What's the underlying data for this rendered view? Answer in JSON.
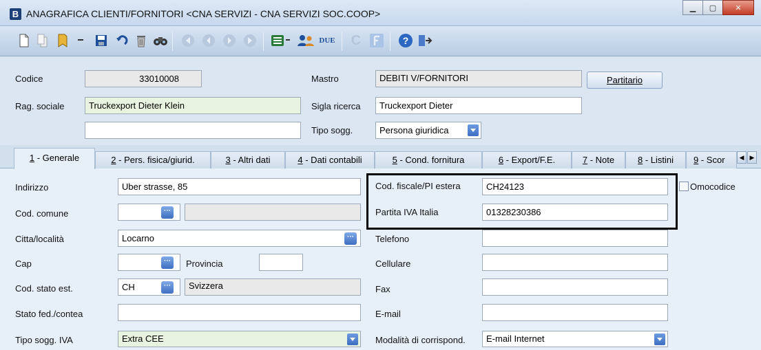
{
  "window": {
    "app_letter": "B",
    "title": "ANAGRAFICA CLIENTI/FORNITORI <CNA SERVIZI - CNA SERVIZI SOC.COOP>"
  },
  "toolbar": {
    "icons": [
      "new-doc-icon",
      "copy-doc-icon",
      "bookmark-icon",
      "save-icon",
      "undo-icon",
      "delete-icon",
      "binoculars-icon",
      "first-icon",
      "prev-icon",
      "next-icon",
      "last-icon",
      "list-icon",
      "people-icon",
      "due-icon",
      "c-icon",
      "f-icon",
      "help-icon",
      "exit-icon"
    ],
    "due_label": "DUE"
  },
  "header": {
    "codice_label": "Codice",
    "codice_value": "33010008",
    "mastro_label": "Mastro",
    "mastro_value": "DEBITI V/FORNITORI",
    "partitario_label": "Partitario",
    "rag_sociale_label": "Rag. sociale",
    "rag_sociale_value": "Truckexport Dieter Klein",
    "rag_sociale_2_value": "",
    "sigla_label": "Sigla ricerca",
    "sigla_value": "Truckexport Dieter",
    "tipo_sogg_label": "Tipo sogg.",
    "tipo_sogg_value": "Persona giuridica"
  },
  "tabs": [
    {
      "key": "1",
      "label": " - Generale"
    },
    {
      "key": "2",
      "label": " - Pers. fisica/giurid."
    },
    {
      "key": "3",
      "label": " - Altri dati"
    },
    {
      "key": "4",
      "label": " - Dati contabili"
    },
    {
      "key": "5",
      "label": " - Cond. fornitura"
    },
    {
      "key": "6",
      "label": " - Export/F.E."
    },
    {
      "key": "7",
      "label": " - Note"
    },
    {
      "key": "8",
      "label": " - Listini"
    },
    {
      "key": "9",
      "label": " - Scor"
    }
  ],
  "general": {
    "indirizzo_label": "Indirizzo",
    "indirizzo_value": "Uber strasse, 85",
    "cod_comune_label": "Cod. comune",
    "cod_comune_value": "",
    "comune_desc_value": "",
    "citta_label": "Citta/località",
    "citta_value": "Locarno",
    "cap_label": "Cap",
    "cap_value": "",
    "provincia_label": "Provincia",
    "provincia_value": "",
    "stato_label": "Cod. stato est.",
    "stato_value": "CH",
    "stato_desc_value": "Svizzera",
    "stato_fed_label": "Stato fed./contea",
    "stato_fed_value": "",
    "tipo_iva_label": "Tipo sogg. IVA",
    "tipo_iva_value": "Extra CEE",
    "cf_estera_label": "Cod. fiscale/PI estera",
    "cf_estera_value": "CH24123",
    "piva_label": "Partita IVA Italia",
    "piva_value": "01328230386",
    "omocodice_label": "Omocodice",
    "telefono_label": "Telefono",
    "telefono_value": "",
    "cellulare_label": "Cellulare",
    "cellulare_value": "",
    "fax_label": "Fax",
    "fax_value": "",
    "email_label": "E-mail",
    "email_value": "",
    "modalita_label": "Modalità di corrispond.",
    "modalita_value": "E-mail Internet"
  }
}
